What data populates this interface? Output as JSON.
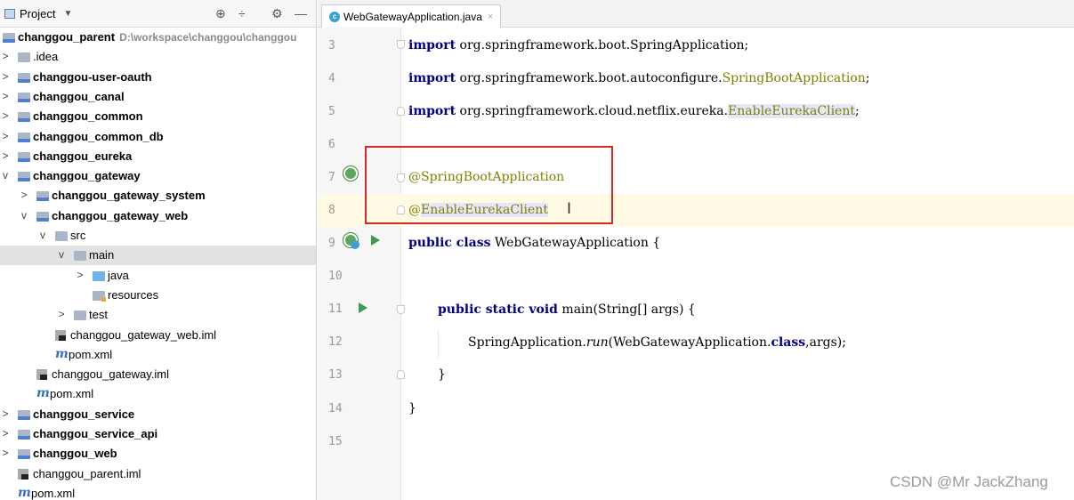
{
  "project_panel": {
    "title": "Project",
    "caret": "▼",
    "tools": [
      "⊕",
      "÷",
      "⚙",
      "—"
    ],
    "tree": [
      {
        "label": "changgou_parent",
        "path": "D:\\workspace\\changgou\\changgou",
        "bold": true,
        "icon": "module-folder-icon",
        "arrow": "",
        "indent": 0
      },
      {
        "label": ".idea",
        "bold": false,
        "icon": "folder-icon",
        "arrow": ">",
        "indent": 0
      },
      {
        "label": "changgou-user-oauth",
        "bold": true,
        "icon": "module-folder-icon",
        "arrow": ">",
        "indent": 0
      },
      {
        "label": "changgou_canal",
        "bold": true,
        "icon": "module-folder-icon",
        "arrow": ">",
        "indent": 0
      },
      {
        "label": "changgou_common",
        "bold": true,
        "icon": "module-folder-icon",
        "arrow": ">",
        "indent": 0
      },
      {
        "label": "changgou_common_db",
        "bold": true,
        "icon": "module-folder-icon",
        "arrow": ">",
        "indent": 0
      },
      {
        "label": "changgou_eureka",
        "bold": true,
        "icon": "module-folder-icon",
        "arrow": ">",
        "indent": 0
      },
      {
        "label": "changgou_gateway",
        "bold": true,
        "icon": "module-folder-icon",
        "arrow": "v",
        "indent": 0
      },
      {
        "label": "changgou_gateway_system",
        "bold": true,
        "icon": "module-folder-icon",
        "arrow": ">",
        "indent": 1
      },
      {
        "label": "changgou_gateway_web",
        "bold": true,
        "icon": "module-folder-icon",
        "arrow": "v",
        "indent": 1
      },
      {
        "label": "src",
        "bold": false,
        "icon": "folder-icon",
        "arrow": "v",
        "indent": 2
      },
      {
        "label": "main",
        "bold": false,
        "icon": "folder-icon",
        "arrow": "v",
        "indent": 3,
        "selected": true
      },
      {
        "label": "java",
        "bold": false,
        "icon": "source-folder-icon",
        "arrow": ">",
        "indent": 4
      },
      {
        "label": "resources",
        "bold": false,
        "icon": "resources-folder-icon",
        "arrow": "",
        "indent": 4
      },
      {
        "label": "test",
        "bold": false,
        "icon": "folder-icon",
        "arrow": ">",
        "indent": 3
      },
      {
        "label": "changgou_gateway_web.iml",
        "bold": false,
        "icon": "iml-file-icon",
        "arrow": "",
        "indent": 2
      },
      {
        "label": "pom.xml",
        "bold": false,
        "icon": "maven-pom-icon",
        "arrow": "",
        "indent": 2
      },
      {
        "label": "changgou_gateway.iml",
        "bold": false,
        "icon": "iml-file-icon",
        "arrow": "",
        "indent": 1
      },
      {
        "label": "pom.xml",
        "bold": false,
        "icon": "maven-pom-icon",
        "arrow": "",
        "indent": 1
      },
      {
        "label": "changgou_service",
        "bold": true,
        "icon": "module-folder-icon",
        "arrow": ">",
        "indent": 0
      },
      {
        "label": "changgou_service_api",
        "bold": true,
        "icon": "module-folder-icon",
        "arrow": ">",
        "indent": 0
      },
      {
        "label": "changgou_web",
        "bold": true,
        "icon": "module-folder-icon",
        "arrow": ">",
        "indent": 0
      },
      {
        "label": "changgou_parent.iml",
        "bold": false,
        "icon": "iml-file-icon",
        "arrow": "",
        "indent": 0
      },
      {
        "label": "pom.xml",
        "bold": false,
        "icon": "maven-pom-icon",
        "arrow": "",
        "indent": 0
      }
    ]
  },
  "editor": {
    "tab": {
      "label": "WebGatewayApplication.java",
      "close": "×",
      "icon": "c"
    },
    "line_numbers": [
      "3",
      "4",
      "5",
      "6",
      "7",
      "8",
      "9",
      "10",
      "11",
      "12",
      "13",
      "14",
      "15"
    ],
    "code": {
      "l3_kw": "import",
      "l3_text": " org.springframework.boot.SpringApplication;",
      "l4_kw": "import",
      "l4_text": " org.springframework.boot.autoconfigure.",
      "l4_cls": "SpringBootApplication",
      "l4_end": ";",
      "l5_kw": "import",
      "l5_text": " org.springframework.cloud.netflix.eureka.",
      "l5_cls": "EnableEurekaClient",
      "l5_end": ";",
      "l7_ann": "@SpringBootApplication",
      "l8_at": "@",
      "l8_ann": "EnableEurekaClient",
      "l9_kw": "public class",
      "l9_text": " WebGatewayApplication {",
      "l11_kw": "public static void",
      "l11_text": " main(String[] args) {",
      "l12_a": "SpringApplication.",
      "l12_run": "run",
      "l12_b": "(WebGatewayApplication.",
      "l12_kw": "class",
      "l12_c": ",args);",
      "l13": "}",
      "l14": "}"
    },
    "text_cursor": "I"
  },
  "watermark": "CSDN @Mr JackZhang"
}
